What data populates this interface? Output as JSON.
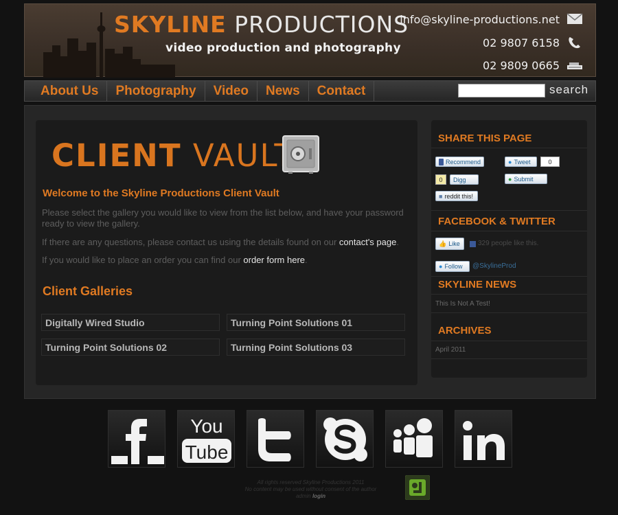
{
  "header": {
    "brand_part1": "SKYLINE",
    "brand_part2": "PRODUCTIONS",
    "tagline": "video production and photography",
    "email": "info@skyline-productions.net",
    "phone1": "02 9807 6158",
    "phone2": "02 9809 0665",
    "colors": {
      "accent": "#e07a22",
      "header_bg": "#3a2f27"
    }
  },
  "nav": {
    "items": [
      "About Us",
      "Photography",
      "Video",
      "News",
      "Contact"
    ],
    "search_label": "search",
    "search_placeholder": ""
  },
  "main": {
    "vault_title_part1": "CLIENT",
    "vault_title_part2": "VAULT",
    "welcome": "Welcome to the Skyline Productions Client Vault",
    "para1": "Please select the gallery you would like to view from the list below, and have your password ready to view the gallery.",
    "para2_pre": "If there are any questions, please contact us using the details found on our ",
    "para2_link": "contact's page",
    "para2_post": ".",
    "para3_pre": "If you would like to place an order you can find our ",
    "para3_link": "order form here",
    "para3_post": ".",
    "galleries_title": "Client Galleries",
    "galleries": [
      "Digitally Wired Studio",
      "Turning Point Solutions 01",
      "Turning Point Solutions 02",
      "Turning Point Solutions 03"
    ]
  },
  "sidebar": {
    "share_title": "SHARE THIS PAGE",
    "recommend": "Recommend",
    "tweet": "Tweet",
    "tweet_count": "0",
    "digg_count": "0",
    "digg": "Digg",
    "submit": "Submit",
    "reddit": "reddit this!",
    "fbtw_title": "FACEBOOK & TWITTER",
    "like": "Like",
    "like_text": "329 people like this.",
    "follow": "Follow",
    "handle": "@SkylineProd",
    "news_title": "SKYLINE NEWS",
    "news_item": "This Is Not A Test!",
    "archives_title": "ARCHIVES",
    "archive_item": "April 2011"
  },
  "social": {
    "icons": [
      "facebook-icon",
      "youtube-icon",
      "twitter-icon",
      "skype-icon",
      "myspace-icon",
      "linkedin-icon"
    ],
    "youtube_top": "You",
    "youtube_bottom": "Tube"
  },
  "footer": {
    "line1": "All rights reserved Skyline Productions 2011",
    "line2": "No content may be used without consent of the author",
    "line3_pre": "admin ",
    "line3_link": "login"
  }
}
